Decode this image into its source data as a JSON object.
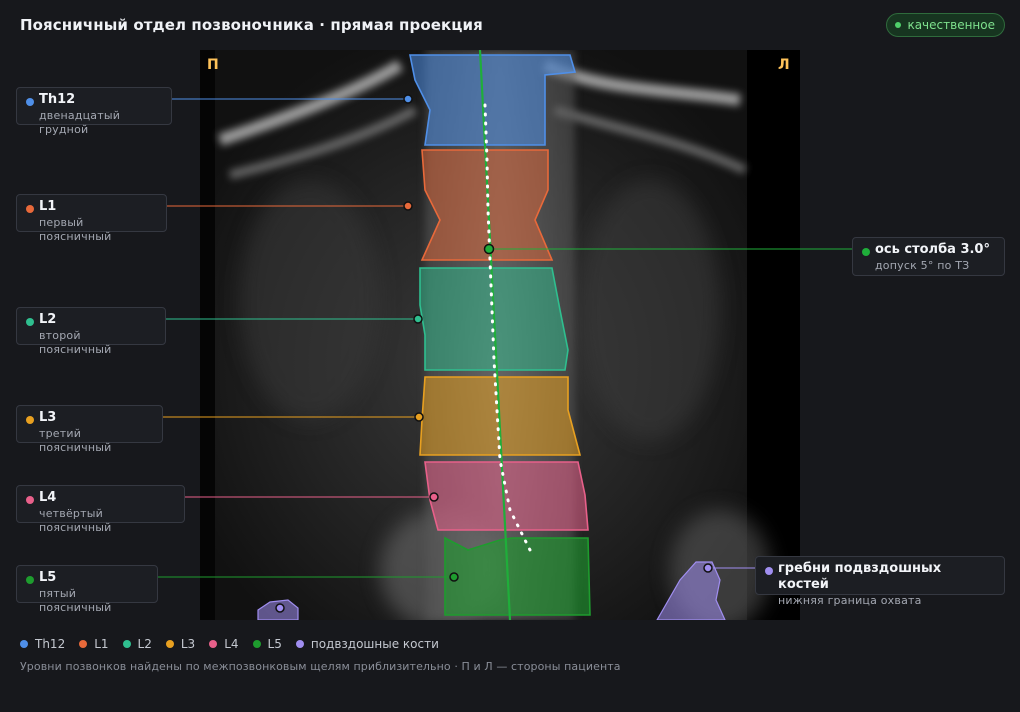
{
  "header": {
    "title": "Поясничный отдел позвоночника · прямая проекция",
    "quality_badge": "качественное",
    "badge_color": "#4fd06a"
  },
  "viewer": {
    "side_left": "П",
    "side_right": "Л"
  },
  "vertebrae": [
    {
      "id": "Th12",
      "label": "Th12",
      "desc": "двенадцатый грудной",
      "color": "#4f8fe8"
    },
    {
      "id": "L1",
      "label": "L1",
      "desc": "первый поясничный",
      "color": "#e8693a"
    },
    {
      "id": "L2",
      "label": "L2",
      "desc": "второй поясничный",
      "color": "#2fbf8f"
    },
    {
      "id": "L3",
      "label": "L3",
      "desc": "третий поясничный",
      "color": "#e8a020"
    },
    {
      "id": "L4",
      "label": "L4",
      "desc": "четвёртый поясничный",
      "color": "#e8608a"
    },
    {
      "id": "L5",
      "label": "L5",
      "desc": "пятый поясничный",
      "color": "#1e9c2e"
    }
  ],
  "axis": {
    "label": "ось столба 3.0°",
    "desc": "допуск 5° по ТЗ",
    "color": "#1fae3a"
  },
  "iliac": {
    "label": "гребни подвздошных костей",
    "desc": "нижняя граница охвата",
    "color": "#a08ef0"
  },
  "legend": [
    {
      "label": "Th12",
      "color": "#4f8fe8"
    },
    {
      "label": "L1",
      "color": "#e8693a"
    },
    {
      "label": "L2",
      "color": "#2fbf8f"
    },
    {
      "label": "L3",
      "color": "#e8a020"
    },
    {
      "label": "L4",
      "color": "#e8608a"
    },
    {
      "label": "L5",
      "color": "#1e9c2e"
    },
    {
      "label": "подвздошные кости",
      "color": "#a08ef0"
    }
  ],
  "footnote": "Уровни позвонков найдены по межпозвонковым щелям приблизительно · П и Л — стороны пациента"
}
